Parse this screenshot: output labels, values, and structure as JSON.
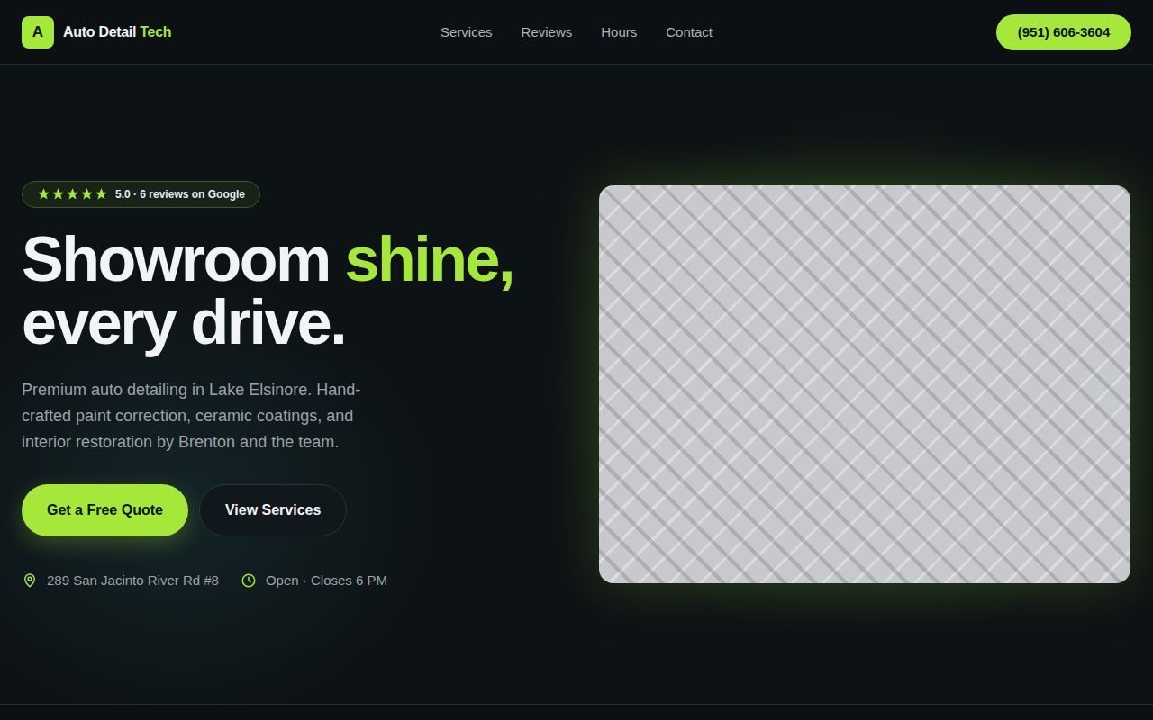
{
  "header": {
    "logo": {
      "mark": "A",
      "name": "Auto Detail",
      "accent": "Tech"
    },
    "nav": [
      "Services",
      "Reviews",
      "Hours",
      "Contact"
    ],
    "phone": "(951) 606-3604"
  },
  "hero": {
    "rating": {
      "stars": 5,
      "text": "5.0 · 6 reviews on Google"
    },
    "headline": {
      "line1": "Showroom",
      "accent": "shine,",
      "line2": "every drive."
    },
    "description": "Premium auto detailing in Lake Elsinore. Hand-crafted paint correction, ceramic coatings, and interior restoration by Brenton and the team.",
    "buttons": [
      {
        "label": "Get a Free Quote",
        "kind": "primary"
      },
      {
        "label": "View Services",
        "kind": "secondary"
      }
    ],
    "info": [
      {
        "kind": "location",
        "text": "289 San Jacinto River Rd #8"
      },
      {
        "kind": "hours",
        "text": "Open · Closes 6 PM"
      }
    ]
  }
}
